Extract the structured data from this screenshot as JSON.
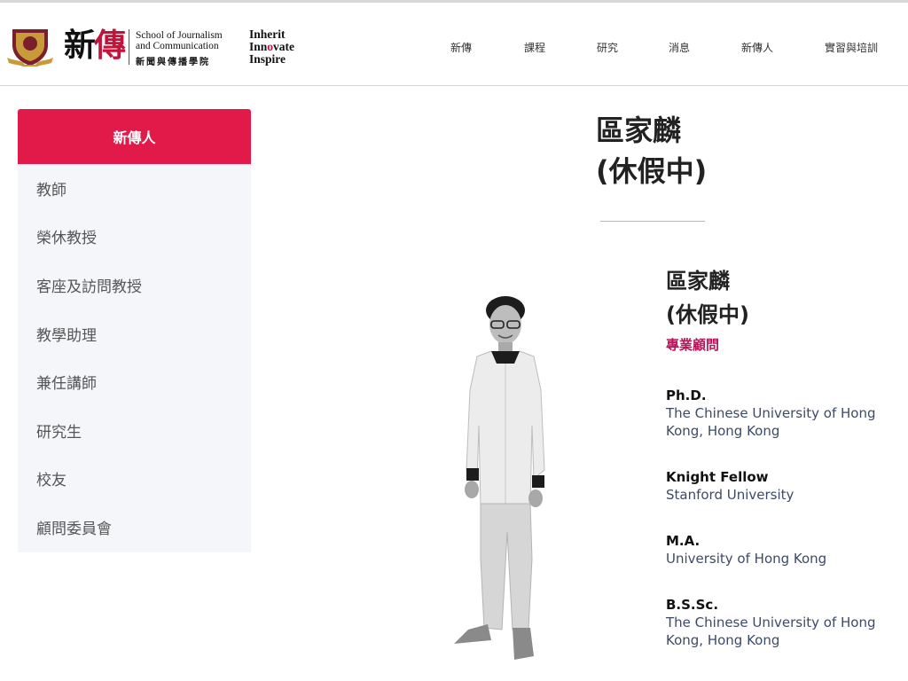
{
  "header": {
    "logo_main": "新",
    "logo_accent": "傳",
    "logo_en_line1": "School of Journalism",
    "logo_en_line2": "and Communication",
    "logo_zh": "新聞與傳播學院",
    "motto": {
      "line1": "Inherit",
      "line2_pre": "Inn",
      "line2_dot": "o",
      "line2_post": "vate",
      "line3": "Inspire"
    },
    "nav": [
      "新傳",
      "課程",
      "研究",
      "消息",
      "新傳人",
      "實習與培訓"
    ]
  },
  "sidebar": {
    "active": "新傳人",
    "items": [
      "教師",
      "榮休教授",
      "客座及訪問教授",
      "教學助理",
      "兼任講師",
      "研究生",
      "校友",
      "顧問委員會"
    ]
  },
  "profile": {
    "title_line1": "區家麟",
    "title_line2": "(休假中)",
    "name_line1": "區家麟",
    "name_line2": "(休假中)",
    "role": "專業顧問",
    "education": [
      {
        "degree": "Ph.D.",
        "institution": "The Chinese University of Hong Kong, Hong Kong"
      },
      {
        "degree": "Knight Fellow",
        "institution": "Stanford University"
      },
      {
        "degree": "M.A.",
        "institution": "University of Hong Kong"
      },
      {
        "degree": "B.S.Sc.",
        "institution": "The Chinese University of Hong Kong, Hong Kong"
      }
    ]
  },
  "colors": {
    "accent": "#e21a4a",
    "role": "#b7155a",
    "sidebar_bg": "#f4f6f9"
  }
}
